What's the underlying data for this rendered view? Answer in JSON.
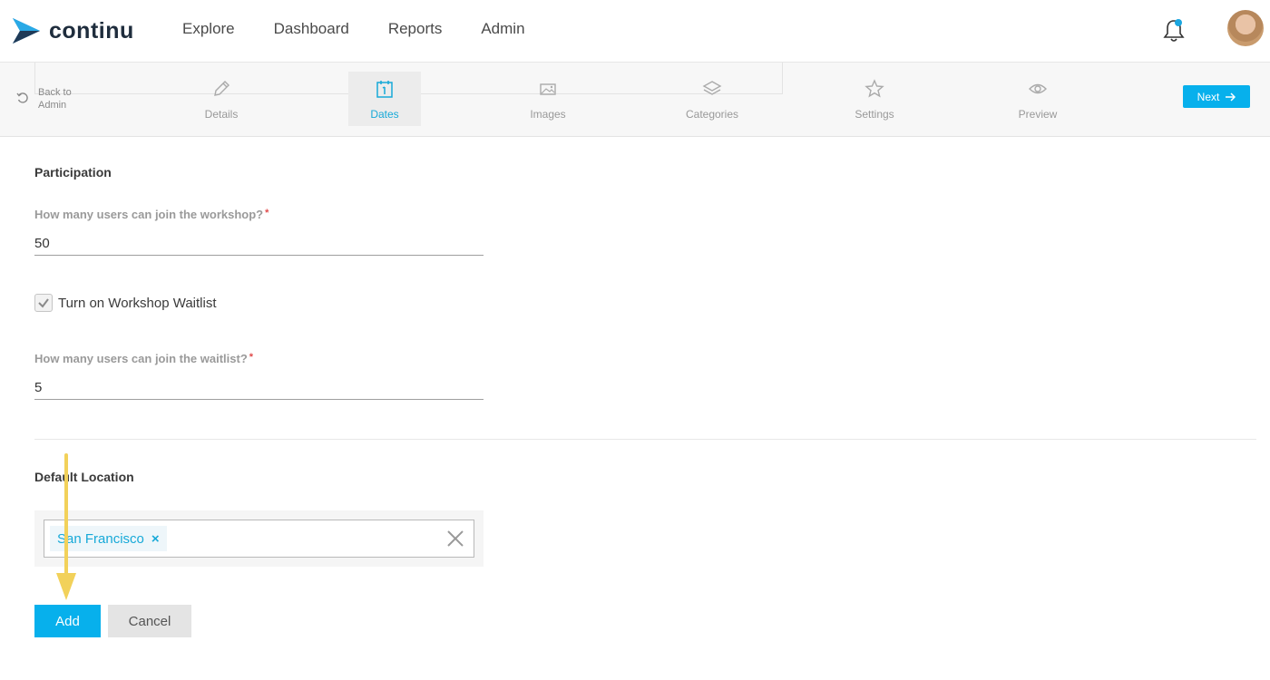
{
  "brand": {
    "name": "continu",
    "logo_icon": "continu-chevron-logo",
    "accent": "#07b0ec"
  },
  "nav": {
    "items": [
      "Explore",
      "Dashboard",
      "Reports",
      "Admin"
    ]
  },
  "header": {
    "notification_icon": "bell-icon",
    "has_unread": true,
    "avatar": "user-avatar"
  },
  "stepbar": {
    "back_label": "Back to Admin",
    "steps": [
      {
        "label": "Details",
        "icon": "pencil-icon",
        "active": false
      },
      {
        "label": "Dates",
        "icon": "calendar-icon",
        "active": true
      },
      {
        "label": "Images",
        "icon": "image-icon",
        "active": false
      },
      {
        "label": "Categories",
        "icon": "layers-icon",
        "active": false
      },
      {
        "label": "Settings",
        "icon": "star-icon",
        "active": false
      },
      {
        "label": "Preview",
        "icon": "eye-icon",
        "active": false
      }
    ],
    "next_label": "Next"
  },
  "form": {
    "participation_heading": "Participation",
    "capacity_label": "How many users can join the workshop?",
    "capacity_value": "50",
    "waitlist_checkbox_label": "Turn on Workshop Waitlist",
    "waitlist_checked": true,
    "waitlist_label": "How many users can join the waitlist?",
    "waitlist_value": "5",
    "required_marker": "*",
    "location_heading": "Default Location",
    "location_tags": [
      "San Francisco"
    ],
    "tag_remove": "×",
    "add_label": "Add",
    "cancel_label": "Cancel"
  }
}
